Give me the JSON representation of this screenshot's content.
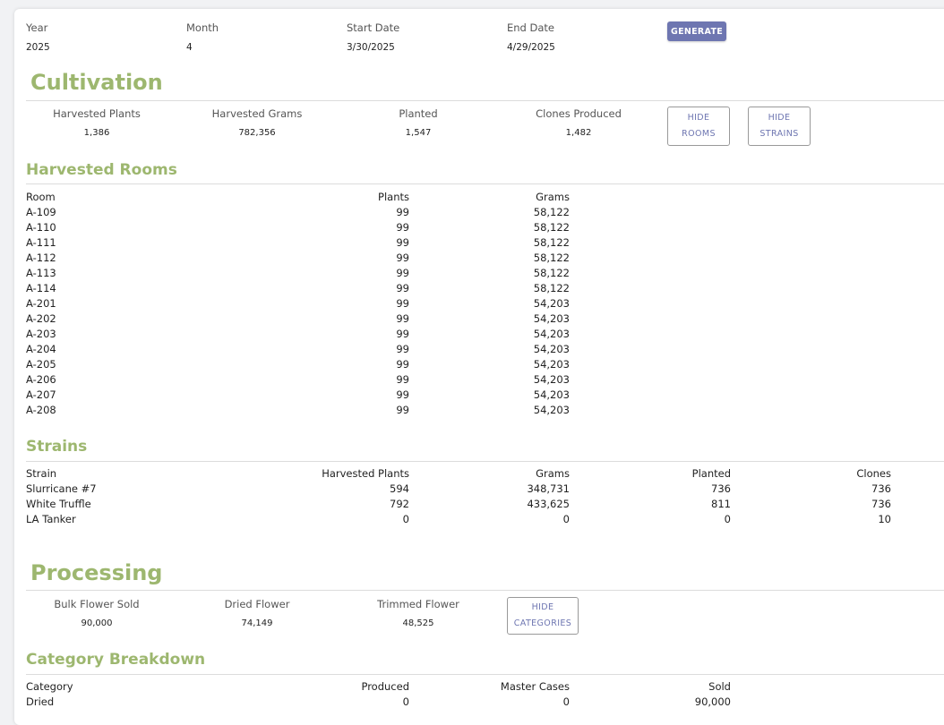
{
  "filters": {
    "year": {
      "label": "Year",
      "value": "2025"
    },
    "month": {
      "label": "Month",
      "value": "4"
    },
    "start_date": {
      "label": "Start Date",
      "value": "3/30/2025"
    },
    "end_date": {
      "label": "End Date",
      "value": "4/29/2025"
    },
    "generate_label": "GENERATE"
  },
  "cultivation": {
    "title": "Cultivation",
    "stats": [
      {
        "label": "Harvested Plants",
        "value": "1,386"
      },
      {
        "label": "Harvested Grams",
        "value": "782,356"
      },
      {
        "label": "Planted",
        "value": "1,547"
      },
      {
        "label": "Clones Produced",
        "value": "1,482"
      }
    ],
    "hide_rooms_label": [
      "HIDE",
      "ROOMS"
    ],
    "hide_strains_label": [
      "HIDE",
      "STRAINS"
    ]
  },
  "harvested_rooms": {
    "title": "Harvested Rooms",
    "columns": [
      "Room",
      "Plants",
      "Grams"
    ],
    "rows": [
      [
        "A-109",
        "99",
        "58,122"
      ],
      [
        "A-110",
        "99",
        "58,122"
      ],
      [
        "A-111",
        "99",
        "58,122"
      ],
      [
        "A-112",
        "99",
        "58,122"
      ],
      [
        "A-113",
        "99",
        "58,122"
      ],
      [
        "A-114",
        "99",
        "58,122"
      ],
      [
        "A-201",
        "99",
        "54,203"
      ],
      [
        "A-202",
        "99",
        "54,203"
      ],
      [
        "A-203",
        "99",
        "54,203"
      ],
      [
        "A-204",
        "99",
        "54,203"
      ],
      [
        "A-205",
        "99",
        "54,203"
      ],
      [
        "A-206",
        "99",
        "54,203"
      ],
      [
        "A-207",
        "99",
        "54,203"
      ],
      [
        "A-208",
        "99",
        "54,203"
      ]
    ]
  },
  "strains": {
    "title": "Strains",
    "columns": [
      "Strain",
      "Harvested Plants",
      "Grams",
      "Planted",
      "Clones"
    ],
    "rows": [
      [
        "Slurricane #7",
        "594",
        "348,731",
        "736",
        "736"
      ],
      [
        "White Truffle",
        "792",
        "433,625",
        "811",
        "736"
      ],
      [
        "LA Tanker",
        "0",
        "0",
        "0",
        "10"
      ]
    ]
  },
  "processing": {
    "title": "Processing",
    "stats": [
      {
        "label": "Bulk Flower Sold",
        "value": "90,000"
      },
      {
        "label": "Dried Flower",
        "value": "74,149"
      },
      {
        "label": "Trimmed Flower",
        "value": "48,525"
      }
    ],
    "hide_categories_label": [
      "HIDE",
      "CATEGORIES"
    ]
  },
  "category_breakdown": {
    "title": "Category Breakdown",
    "columns": [
      "Category",
      "Produced",
      "Master Cases",
      "Sold"
    ],
    "rows": [
      [
        "Dried",
        "0",
        "0",
        "90,000"
      ]
    ]
  },
  "colors": {
    "accent_green": "#9db76f",
    "button_purple": "#6e76b1"
  }
}
